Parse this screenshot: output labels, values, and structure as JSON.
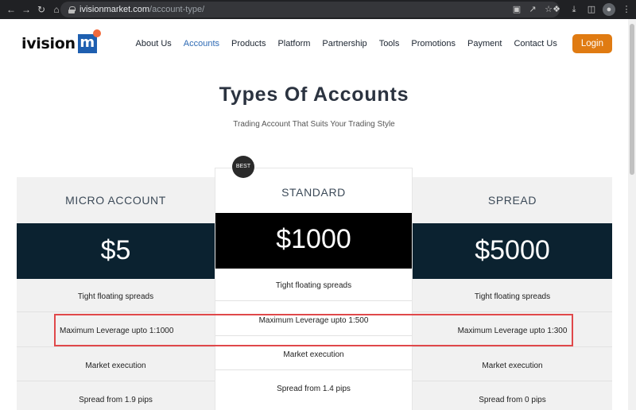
{
  "browser": {
    "url_host": "ivisionmarket.com",
    "url_path": "/account-type/",
    "back_icon": "back-arrow-icon",
    "forward_icon": "forward-arrow-icon",
    "reload_icon": "reload-icon",
    "home_icon": "home-icon"
  },
  "header": {
    "logo_text": "ivision",
    "logo_mark": "m",
    "nav": [
      {
        "label": "About Us",
        "active": false
      },
      {
        "label": "Accounts",
        "active": true
      },
      {
        "label": "Products",
        "active": false
      },
      {
        "label": "Platform",
        "active": false
      },
      {
        "label": "Partnership",
        "active": false
      },
      {
        "label": "Tools",
        "active": false
      },
      {
        "label": "Promotions",
        "active": false
      },
      {
        "label": "Payment",
        "active": false
      },
      {
        "label": "Contact Us",
        "active": false
      }
    ],
    "login_label": "Login",
    "accent_color": "#e07b12",
    "active_color": "#2e6ab4"
  },
  "hero": {
    "title": "Types Of Accounts",
    "subtitle": "Trading Account That Suits Your Trading Style"
  },
  "plans": [
    {
      "name": "MICRO ACCOUNT",
      "price": "$5",
      "band_color": "#0b2230",
      "features": [
        "Tight floating spreads",
        "Maximum Leverage upto 1:1000",
        "Market execution",
        "Spread from 1.9 pips"
      ]
    },
    {
      "name": "STANDARD",
      "price": "$1000",
      "badge": "BEST",
      "band_color": "#000000",
      "features": [
        "Tight floating spreads",
        "Maximum Leverage upto 1:500",
        "Market execution",
        "Spread from 1.4 pips"
      ]
    },
    {
      "name": "SPREAD",
      "price": "$5000",
      "band_color": "#0b2230",
      "features": [
        "Tight floating spreads",
        "Maximum Leverage upto 1:300",
        "Market execution",
        "Spread from 0 pips"
      ]
    }
  ]
}
